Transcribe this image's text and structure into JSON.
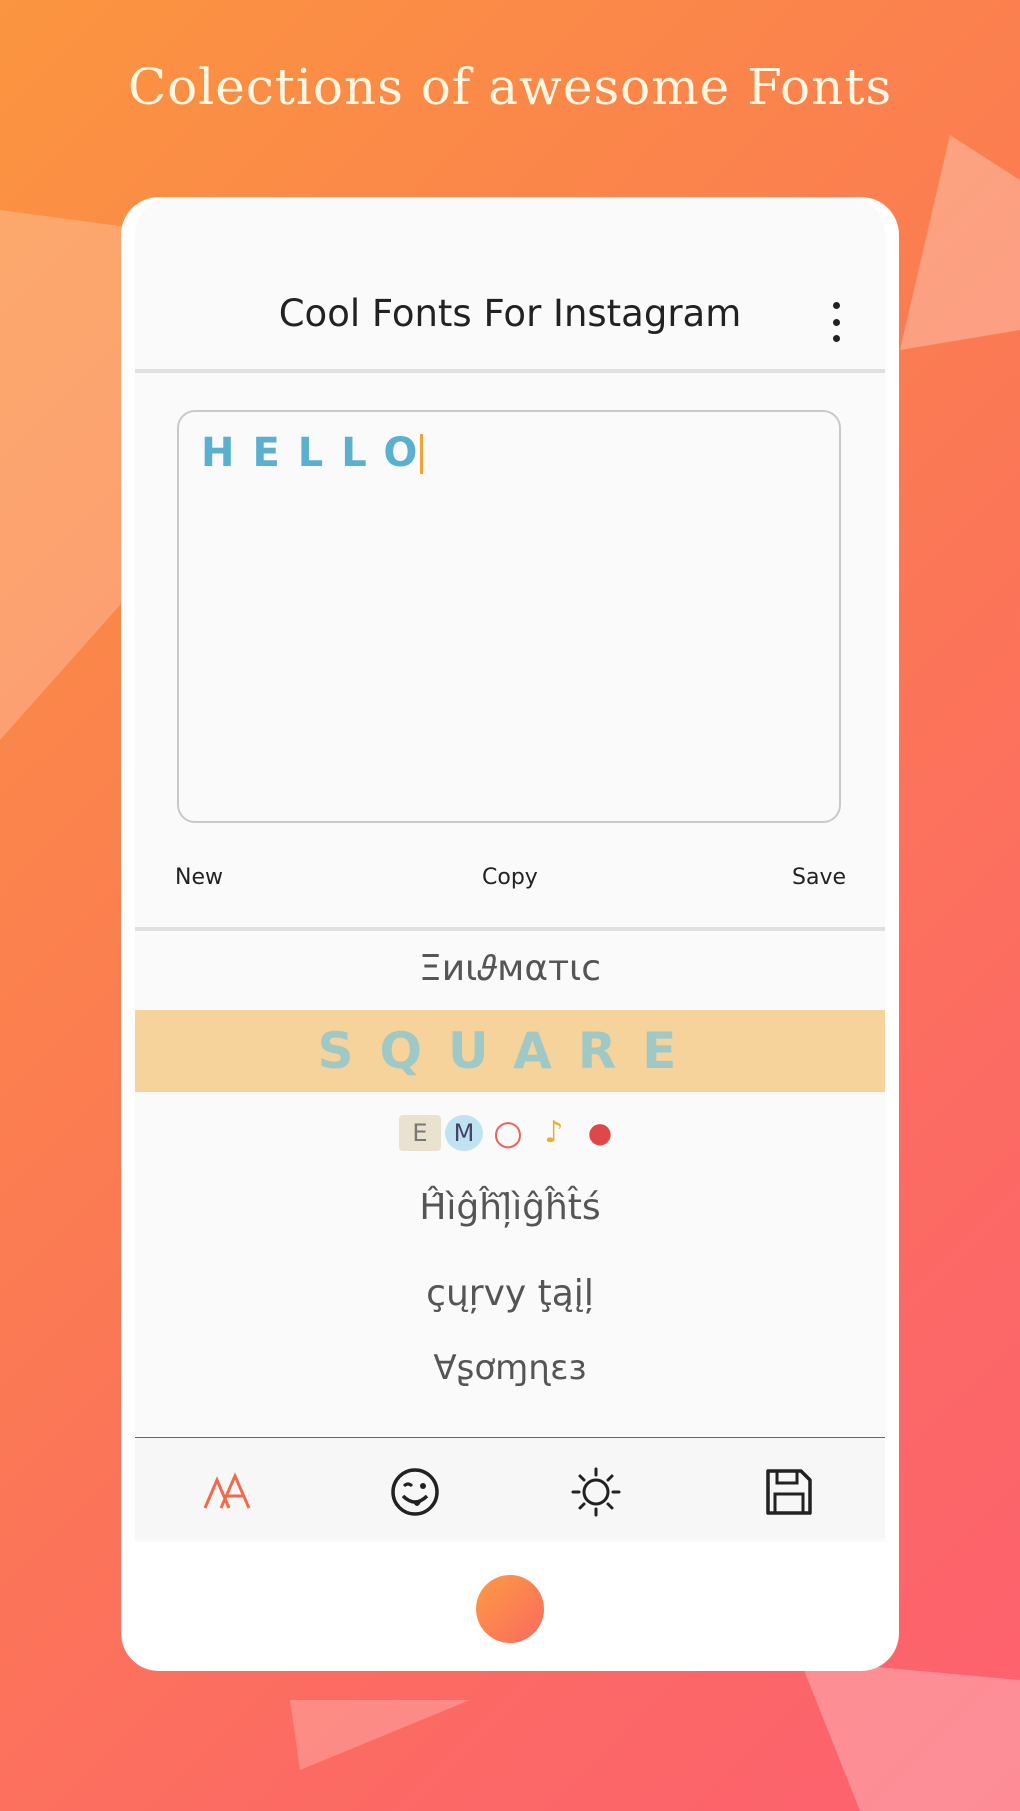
{
  "promo": {
    "title": "Colections of awesome Fonts"
  },
  "app": {
    "title": "Cool Fonts For Instagram",
    "menu_icon": "more-vert-icon"
  },
  "editor": {
    "value": "HELLO"
  },
  "actions": {
    "new_label": "New",
    "copy_label": "Copy",
    "save_label": "Save"
  },
  "fonts": {
    "items": [
      {
        "label": "Ξиι𝜗мαтιc"
      },
      {
        "label": "SQUARE"
      },
      {
        "label": "EMO"
      },
      {
        "label": "Ĥ̂ìĝĥ̂ļ̂ìĝĥ̂t̂ś"
      },
      {
        "label": "çųŗvy ţąįļ"
      },
      {
        "label": "Ɐʂơɱɳɛɜ"
      }
    ]
  },
  "nav": {
    "items": [
      {
        "icon": "font-icon"
      },
      {
        "icon": "emoji-icon"
      },
      {
        "icon": "sun-icon"
      },
      {
        "icon": "save-icon"
      }
    ]
  },
  "colors": {
    "accent": "#f26a4b",
    "highlight_bg": "#f6d39a",
    "editor_text": "#5bb0cf"
  }
}
